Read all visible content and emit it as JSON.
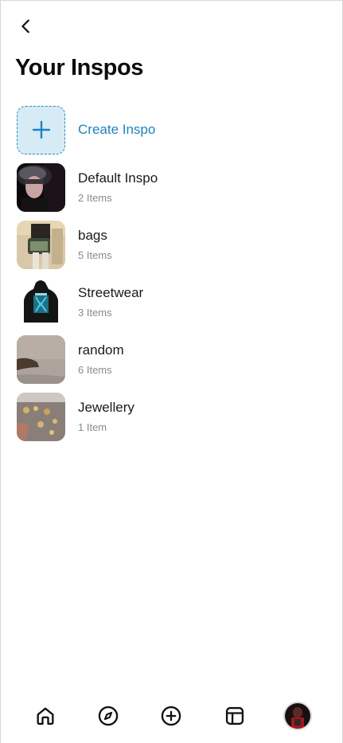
{
  "header": {
    "back_icon": "chevron-left-icon",
    "title": "Your Inspos"
  },
  "create": {
    "label": "Create Inspo",
    "icon": "plus-icon",
    "accent": "#1f82c1",
    "tile_bg": "#d6ebf6"
  },
  "inspos": [
    {
      "name": "Default Inspo",
      "count": "2 Items"
    },
    {
      "name": "bags",
      "count": "5 Items"
    },
    {
      "name": "Streetwear",
      "count": "3 Items"
    },
    {
      "name": "random",
      "count": "6 Items"
    },
    {
      "name": "Jewellery",
      "count": "1 Item"
    }
  ],
  "bottom_nav": [
    {
      "icon": "home-icon"
    },
    {
      "icon": "compass-icon"
    },
    {
      "icon": "add-circle-icon"
    },
    {
      "icon": "layout-icon"
    },
    {
      "icon": "profile-avatar"
    }
  ]
}
